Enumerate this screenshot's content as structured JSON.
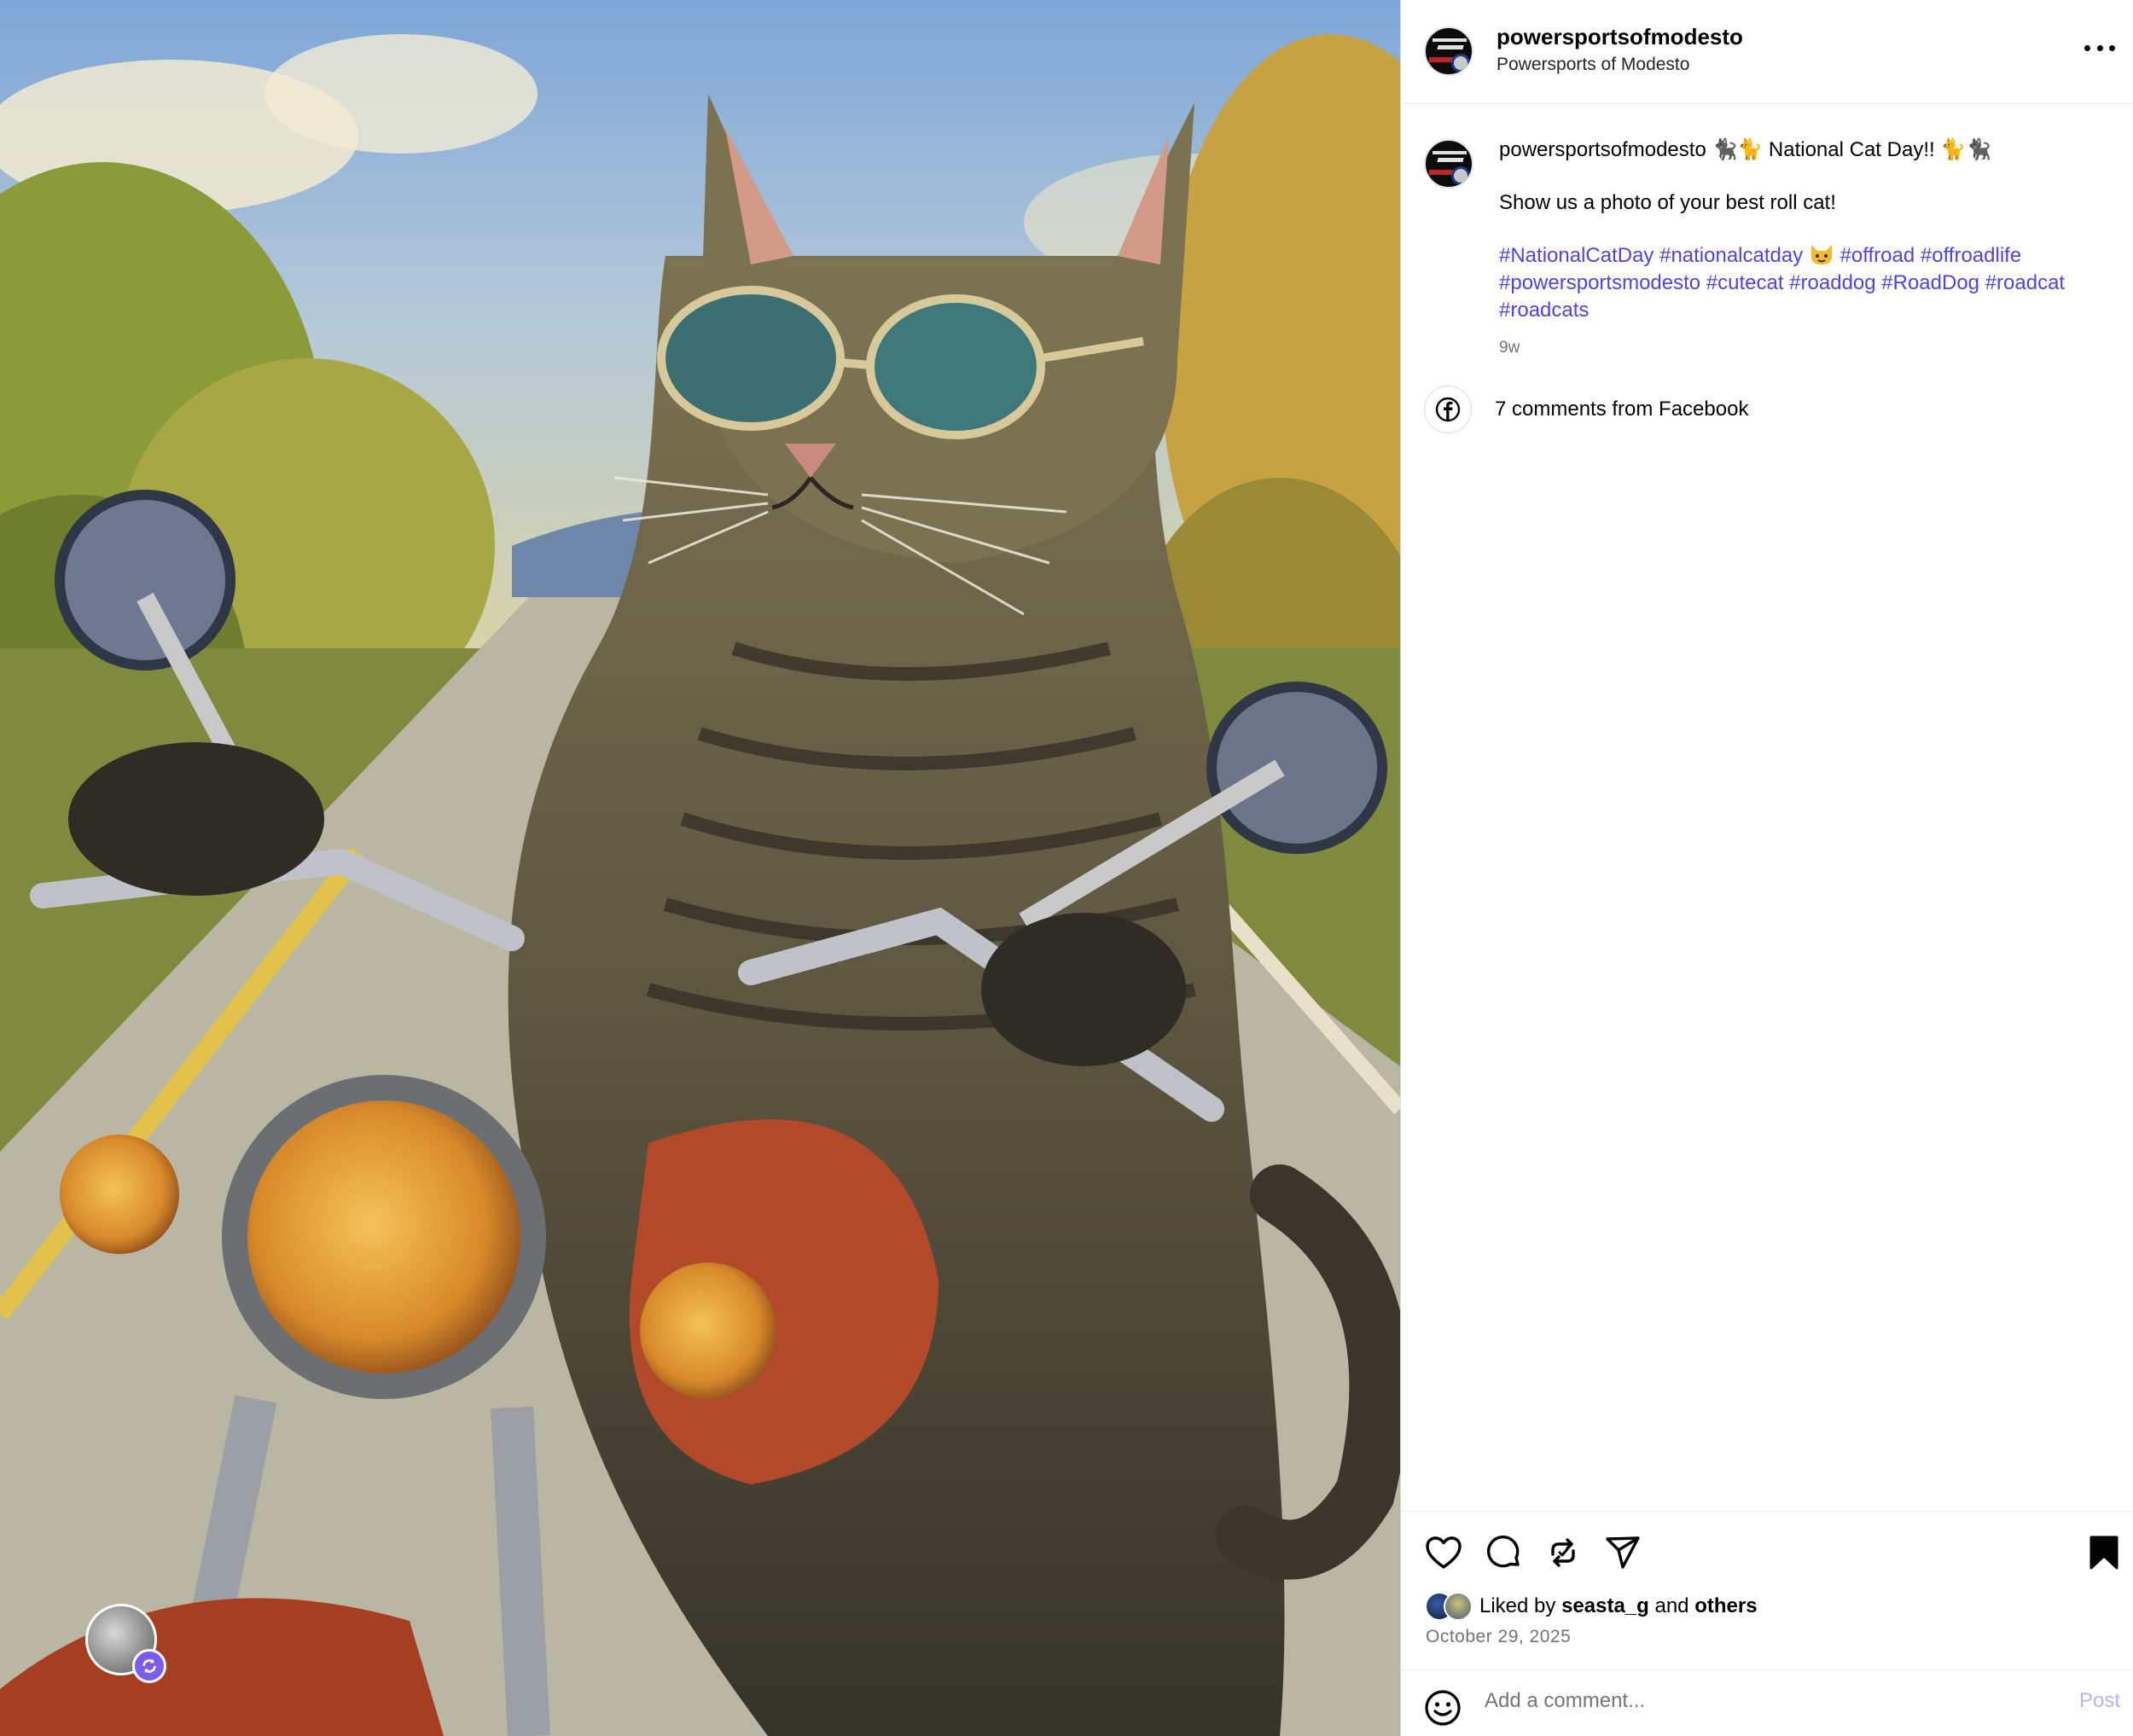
{
  "post": {
    "image_alt": "Painting of a tabby cat wearing sunglasses riding a motorcycle",
    "header": {
      "username": "powersportsofmodesto",
      "subtitle": "Powersports of Modesto"
    },
    "caption": {
      "username": "powersportsofmodesto",
      "headline": "🐈‍⬛🐈 National Cat Day!! 🐈🐈‍⬛",
      "line2": "Show us a photo of your best roll cat!",
      "hashtags_1": "#NationalCatDay #nationalcatday",
      "hashtags_2": "#offroad #offroadlife #powersportsmodesto #cutecat #roaddog #RoadDog #roadcat #roadcats",
      "time": "9w"
    },
    "facebook_comments": "7 comments from Facebook",
    "likes": {
      "prefix": "Liked by",
      "user": "seasta_g",
      "joiner": "and",
      "suffix": "others"
    },
    "date": "October 29, 2025",
    "comment_input_placeholder": "Add a comment...",
    "post_button": "Post"
  },
  "icons": {
    "more": "more-options-icon",
    "like": "heart-icon",
    "comment": "comment-icon",
    "repost": "repost-icon",
    "share": "send-icon",
    "save": "bookmark-icon",
    "emoji": "emoji-icon",
    "facebook": "facebook-icon"
  },
  "colors": {
    "hashtag": "#4b45e8",
    "muted": "#737373",
    "post_disabled": "#b7b3f7"
  }
}
